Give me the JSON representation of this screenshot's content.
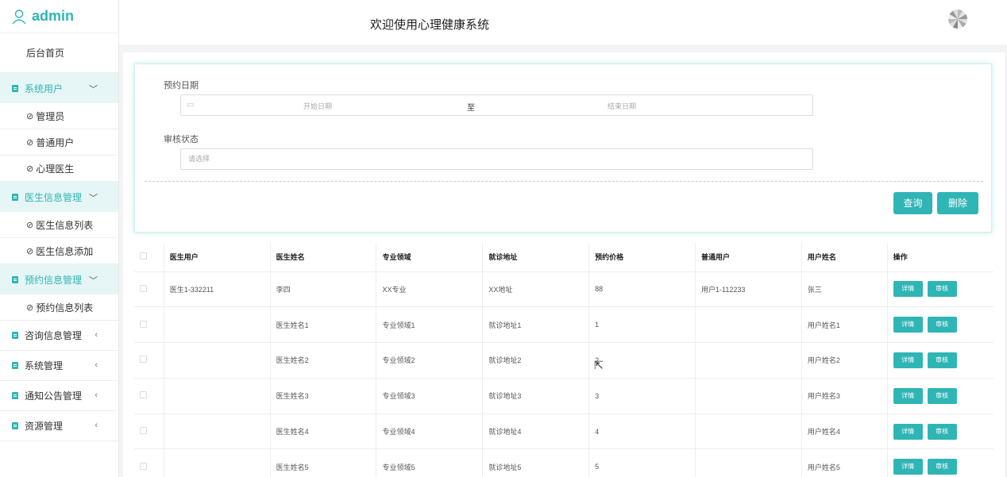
{
  "brand": {
    "name": "admin"
  },
  "header": {
    "title": "欢迎使用心理健康系统"
  },
  "sidebar": {
    "home": "后台首页",
    "groups": [
      {
        "label": "系统用户",
        "open": true,
        "items": [
          "管理员",
          "普通用户",
          "心理医生"
        ]
      },
      {
        "label": "医生信息管理",
        "open": true,
        "items": [
          "医生信息列表",
          "医生信息添加"
        ]
      },
      {
        "label": "预约信息管理",
        "open": true,
        "items": [
          "预约信息列表"
        ]
      },
      {
        "label": "咨询信息管理",
        "open": false,
        "items": []
      },
      {
        "label": "系统管理",
        "open": false,
        "items": []
      },
      {
        "label": "通知公告管理",
        "open": false,
        "items": []
      },
      {
        "label": "资源管理",
        "open": false,
        "items": []
      }
    ]
  },
  "search": {
    "date_label": "预约日期",
    "start_placeholder": "开始日期",
    "separator": "至",
    "end_placeholder": "结束日期",
    "status_label": "审核状态",
    "status_placeholder": "请选择",
    "query_button": "查询",
    "delete_button": "删除"
  },
  "table": {
    "headers": [
      "医生用户",
      "医生姓名",
      "专业领域",
      "就诊地址",
      "预约价格",
      "普通用户",
      "用户姓名",
      "操作"
    ],
    "detail_label": "详情",
    "review_label": "审核",
    "rows": [
      [
        "医生1-332211",
        "李四",
        "XX专业",
        "XX地址",
        "88",
        "用户1-112233",
        "张三"
      ],
      [
        "",
        "医生姓名1",
        "专业领域1",
        "就诊地址1",
        "1",
        "",
        "用户姓名1"
      ],
      [
        "",
        "医生姓名2",
        "专业领域2",
        "就诊地址2",
        "2",
        "",
        "用户姓名2"
      ],
      [
        "",
        "医生姓名3",
        "专业领域3",
        "就诊地址3",
        "3",
        "",
        "用户姓名3"
      ],
      [
        "",
        "医生姓名4",
        "专业领域4",
        "就诊地址4",
        "4",
        "",
        "用户姓名4"
      ],
      [
        "",
        "医生姓名5",
        "专业领域5",
        "就诊地址5",
        "5",
        "",
        "用户姓名5"
      ]
    ]
  },
  "colors": {
    "accent": "#2fb5b5"
  }
}
